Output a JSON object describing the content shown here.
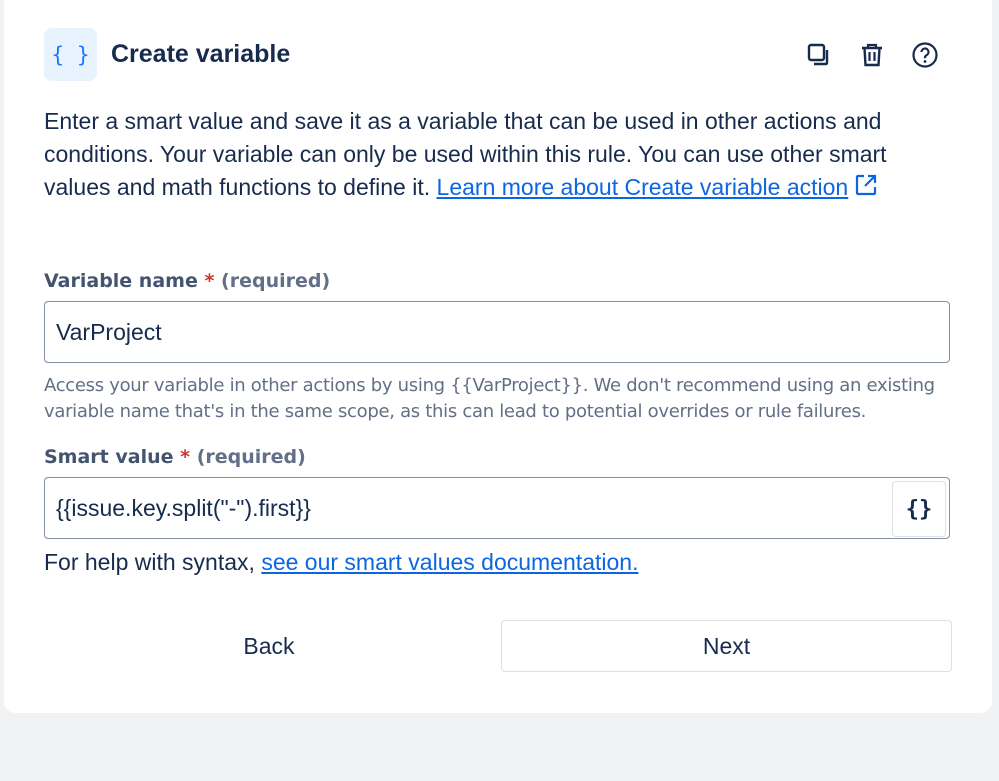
{
  "header": {
    "icon": "curly-braces-icon",
    "title": "Create variable",
    "actions": [
      "duplicate-icon",
      "trash-icon",
      "help-icon"
    ]
  },
  "description": {
    "text": "Enter a smart value and save it as a variable that can be used in other actions and conditions. Your variable can only be used within this rule. You can use other smart values and math functions to define it. ",
    "link_text": "Learn more about Create variable action"
  },
  "variable_name": {
    "label": "Variable name",
    "required_star": "*",
    "required_text": "(required)",
    "value": "VarProject",
    "helper": "Access your variable in other actions by using {{VarProject}}. We don't recommend using an existing variable name that's in the same scope, as this can lead to potential overrides or rule failures."
  },
  "smart_value": {
    "label": "Smart value",
    "required_star": "*",
    "required_text": "(required)",
    "value": "{{issue.key.split(\"-\").first}}",
    "picker_label": "{}"
  },
  "syntax_help": {
    "prefix": "For help with syntax, ",
    "link_text": "see our smart values documentation."
  },
  "buttons": {
    "back": "Back",
    "next": "Next"
  },
  "colors": {
    "link": "#0c66e4",
    "required": "#c9372c",
    "icon_bg": "#e9f2ff",
    "icon_fg": "#1d7afc"
  }
}
